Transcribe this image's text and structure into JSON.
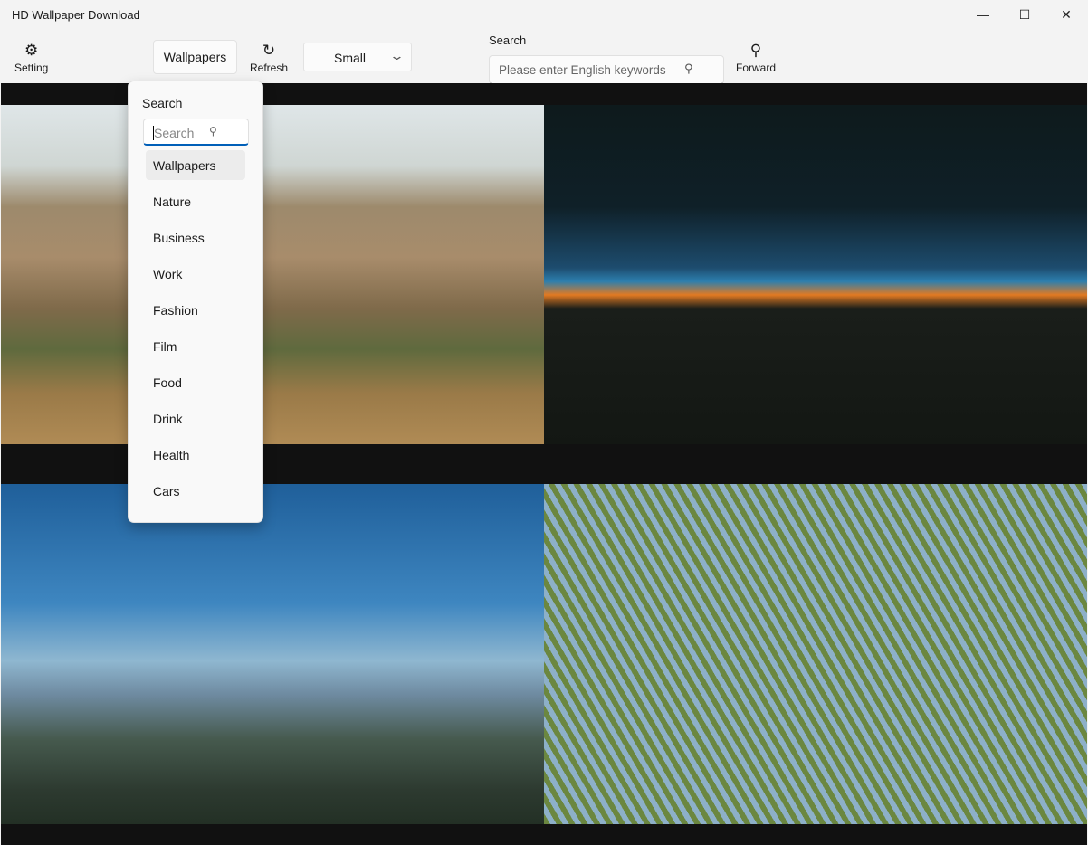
{
  "window": {
    "title": "HD Wallpaper Download",
    "minimize": "—",
    "maximize": "☐",
    "close": "✕"
  },
  "toolbar": {
    "setting_label": "Setting",
    "setting_icon": "⚙",
    "category_button": "Wallpapers",
    "refresh_label": "Refresh",
    "refresh_icon": "↻",
    "size_value": "Small",
    "chevron": "⌄",
    "search_label": "Search",
    "search_placeholder": "Please enter English keywords",
    "search_icon": "⚲",
    "forward_label": "Forward"
  },
  "dropdown": {
    "header": "Search",
    "search_placeholder": "Search",
    "selected": "Wallpapers",
    "items": [
      "Wallpapers",
      "Nature",
      "Business",
      "Work",
      "Fashion",
      "Film",
      "Food",
      "Drink",
      "Health",
      "Cars"
    ]
  }
}
